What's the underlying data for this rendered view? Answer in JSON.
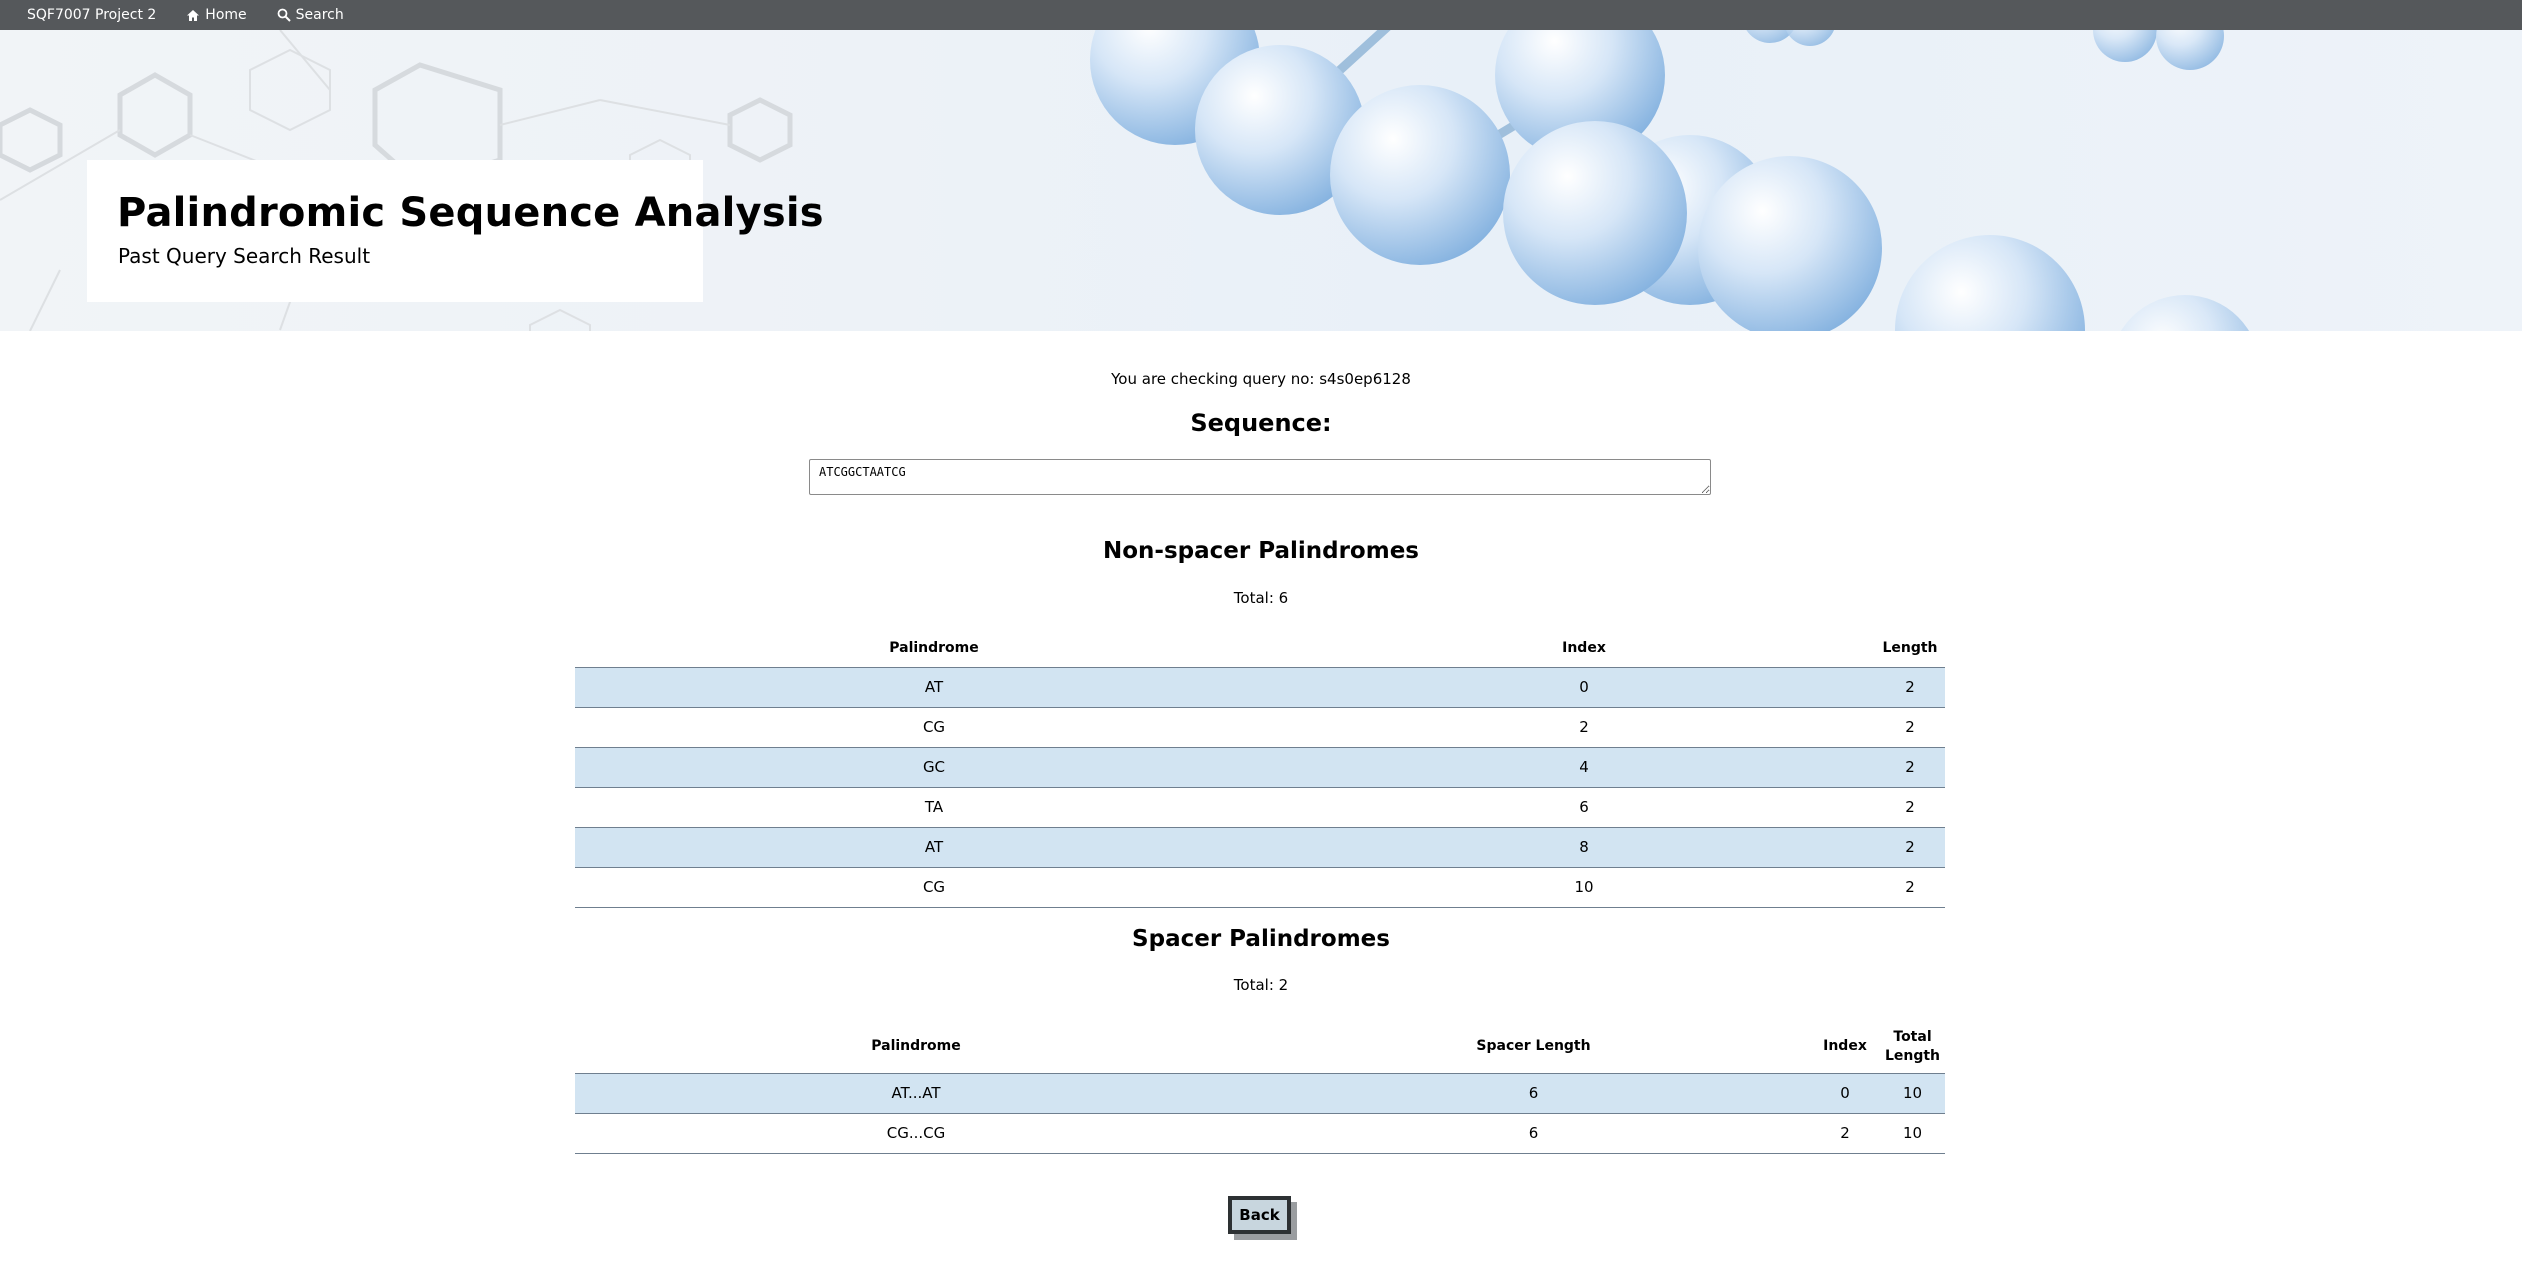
{
  "navbar": {
    "brand": "SQF7007 Project 2",
    "home_label": "Home",
    "search_label": "Search"
  },
  "hero": {
    "title": "Palindromic Sequence Analysis",
    "subtitle": "Past Query Search Result"
  },
  "query": {
    "text": "You are checking query no: s4s0ep6128"
  },
  "sequence": {
    "heading": "Sequence:",
    "value": "ATCGGCTAATCG"
  },
  "non_spacer": {
    "heading": "Non-spacer Palindromes",
    "total": "Total: 6",
    "columns": [
      "Palindrome",
      "Index",
      "Length"
    ],
    "rows": [
      [
        "AT",
        "0",
        "2"
      ],
      [
        "CG",
        "2",
        "2"
      ],
      [
        "GC",
        "4",
        "2"
      ],
      [
        "TA",
        "6",
        "2"
      ],
      [
        "AT",
        "8",
        "2"
      ],
      [
        "CG",
        "10",
        "2"
      ]
    ]
  },
  "spacer": {
    "heading": "Spacer Palindromes",
    "total": "Total: 2",
    "columns": [
      "Palindrome",
      "Spacer Length",
      "Index",
      "Total Length"
    ],
    "rows": [
      [
        "AT...AT",
        "6",
        "0",
        "10"
      ],
      [
        "CG...CG",
        "6",
        "2",
        "10"
      ]
    ]
  },
  "back_label": "Back",
  "colors": {
    "navbar": "#55585b",
    "row_shade": "#d2e4f2",
    "button_bg": "#c8d6de"
  },
  "icons": [
    "home-icon",
    "search-icon"
  ]
}
